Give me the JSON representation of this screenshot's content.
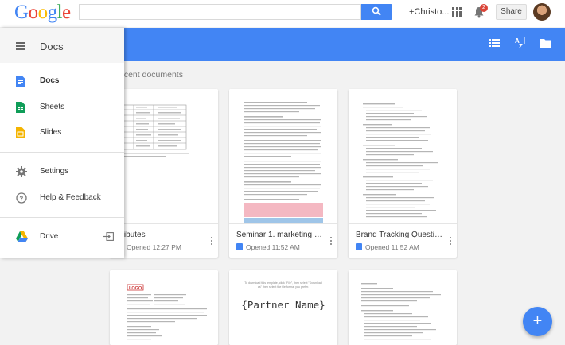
{
  "google": {
    "logo_letters": [
      {
        "ch": "G",
        "color": "#4285f4"
      },
      {
        "ch": "o",
        "color": "#ea4335"
      },
      {
        "ch": "o",
        "color": "#fbbc05"
      },
      {
        "ch": "g",
        "color": "#4285f4"
      },
      {
        "ch": "l",
        "color": "#34a853"
      },
      {
        "ch": "e",
        "color": "#ea4335"
      }
    ],
    "search_value": "",
    "user_label": "+Christo...",
    "notification_count": "2",
    "share_label": "Share"
  },
  "appbar": {
    "icons": [
      "list-view-icon",
      "sort-az-icon",
      "folder-icon"
    ],
    "color": "#4285f4"
  },
  "drawer": {
    "title": "Docs",
    "items": [
      {
        "label": "Docs",
        "icon": "docs-icon",
        "color": "#4285f4"
      },
      {
        "label": "Sheets",
        "icon": "sheets-icon",
        "color": "#0f9d58"
      },
      {
        "label": "Slides",
        "icon": "slides-icon",
        "color": "#f4b400"
      },
      {
        "label": "Settings",
        "icon": "gear-icon"
      },
      {
        "label": "Help & Feedback",
        "icon": "help-icon"
      },
      {
        "label": "Drive",
        "icon": "drive-icon",
        "trailing_icon": "open-in-drive-icon"
      }
    ]
  },
  "main": {
    "recent_label": "ecent documents",
    "documents": [
      {
        "title": "ttributes",
        "opened": "Opened 12:27 PM"
      },
      {
        "title": "Seminar 1. marketing n...",
        "opened": "Opened 11:52 AM"
      },
      {
        "title": "Brand Tracking Questioner",
        "opened": "Opened 11:52 AM"
      }
    ],
    "thumb_texts": {
      "partner_name": "{Partner Name}",
      "template_note": "To download this template, click \"File\", then select \"Download as\" then select the file format you prefer.",
      "logo_text": "LOGO"
    }
  },
  "fab": {
    "label": "+"
  }
}
